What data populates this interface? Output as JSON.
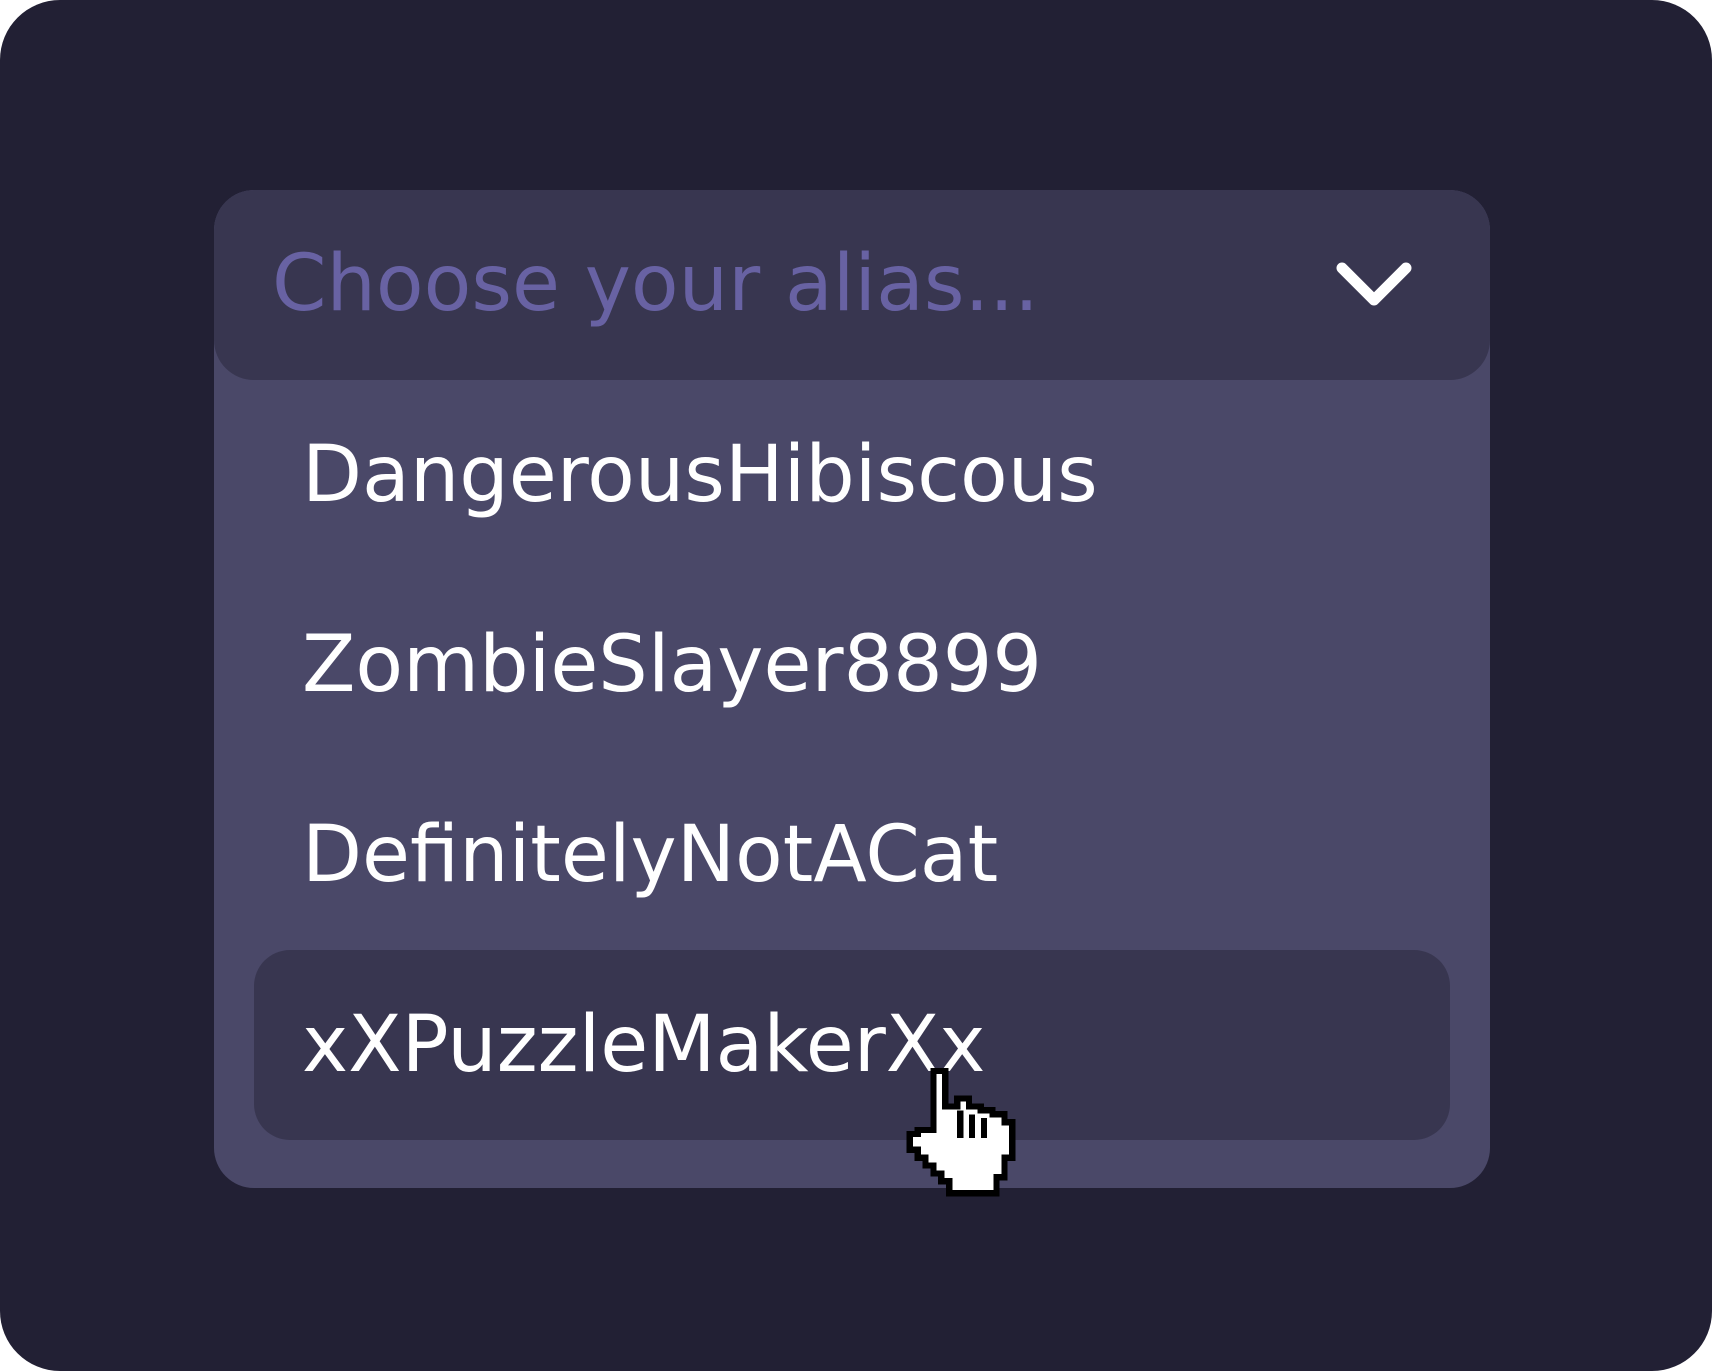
{
  "colors": {
    "background": "#222034",
    "dropdown_panel": "#4a4868",
    "trigger_background": "#383650",
    "hovered_option_background": "#383650",
    "placeholder_text": "#6862a3",
    "option_text": "#ffffff"
  },
  "alias_select": {
    "placeholder": "Choose your alias...",
    "expanded_icon": "chevron-down-icon",
    "options": [
      {
        "label": "DangerousHibiscous",
        "hovered": false
      },
      {
        "label": "ZombieSlayer8899",
        "hovered": false
      },
      {
        "label": "DefinitelyNotACat",
        "hovered": false
      },
      {
        "label": "xXPuzzleMakerXx",
        "hovered": true
      }
    ]
  },
  "cursor": {
    "icon": "hand-pointer-cursor-icon"
  }
}
